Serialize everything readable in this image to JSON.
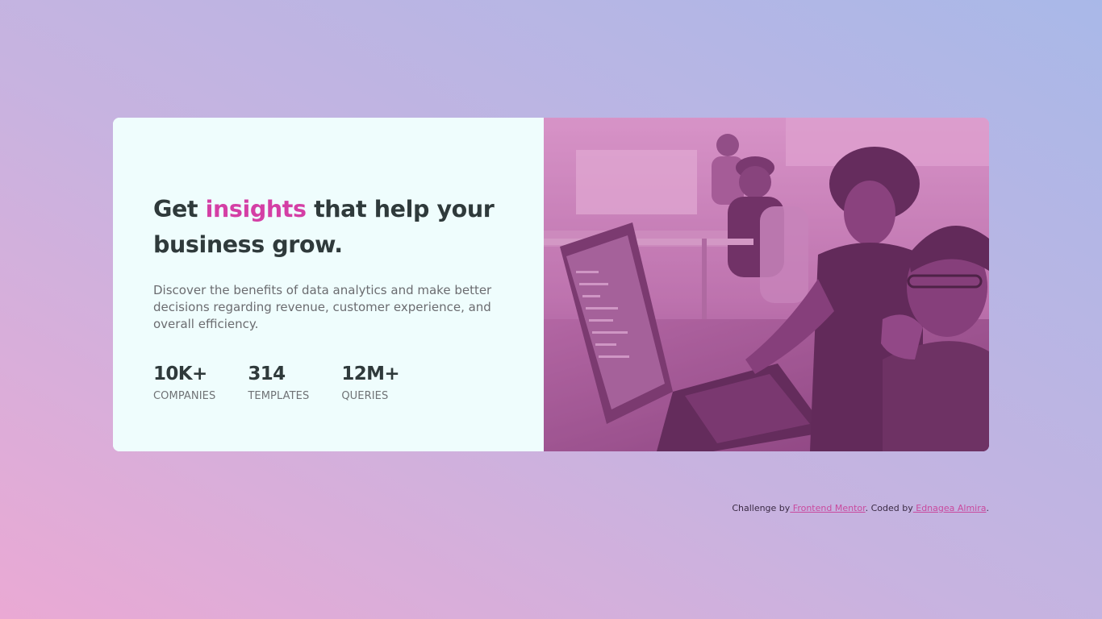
{
  "colors": {
    "accent": "#d43fa5",
    "card_background": "#effdfd",
    "heading": "#2f3a3b",
    "body_text": "#6b6c70",
    "image_overlay": "#aa5c9a",
    "link": "#c94a9e"
  },
  "card": {
    "headline": {
      "before": "Get ",
      "accent": "insights",
      "after": " that help your business grow."
    },
    "description": "Discover the benefits of data analytics and make better decisions regarding revenue, customer experience, and overall efficiency.",
    "stats": [
      {
        "value": "10K+",
        "label": "COMPANIES"
      },
      {
        "value": "314",
        "label": "TEMPLATES"
      },
      {
        "value": "12M+",
        "label": "QUERIES"
      }
    ],
    "image": {
      "description": "photo of people working at laptops in an office, tinted magenta"
    }
  },
  "attribution": {
    "prefix": "Challenge by",
    "challenge_link": " Frontend Mentor",
    "middle": ". Coded by",
    "author_link": " Ednagea Almira",
    "suffix": "."
  }
}
